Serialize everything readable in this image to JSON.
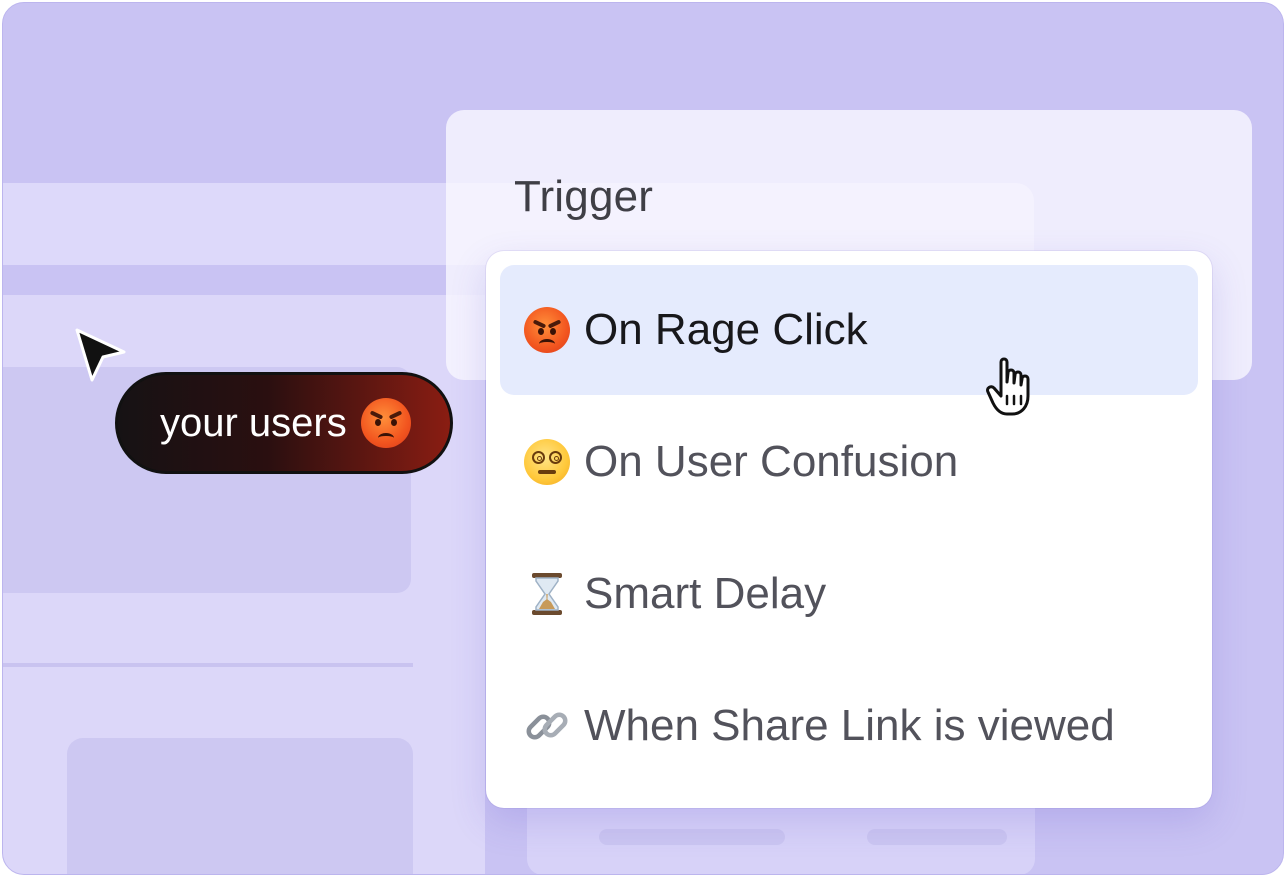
{
  "trigger": {
    "label": "Trigger"
  },
  "dropdown": {
    "items": [
      {
        "label": "On Rage Click",
        "icon": "angry-face-emoji",
        "selected": true
      },
      {
        "label": "On User Confusion",
        "icon": "dizzy-face-emoji",
        "selected": false
      },
      {
        "label": "Smart Delay",
        "icon": "hourglass-emoji",
        "selected": false
      },
      {
        "label": "When Share Link is viewed",
        "icon": "link-emoji",
        "selected": false
      }
    ]
  },
  "user_tag": {
    "label": "your users",
    "icon": "angry-face-emoji"
  },
  "colors": {
    "background": "#c9c3f3",
    "selected_item": "#e5ebfd",
    "tag_start": "#161214",
    "tag_end": "#8a1d12"
  }
}
